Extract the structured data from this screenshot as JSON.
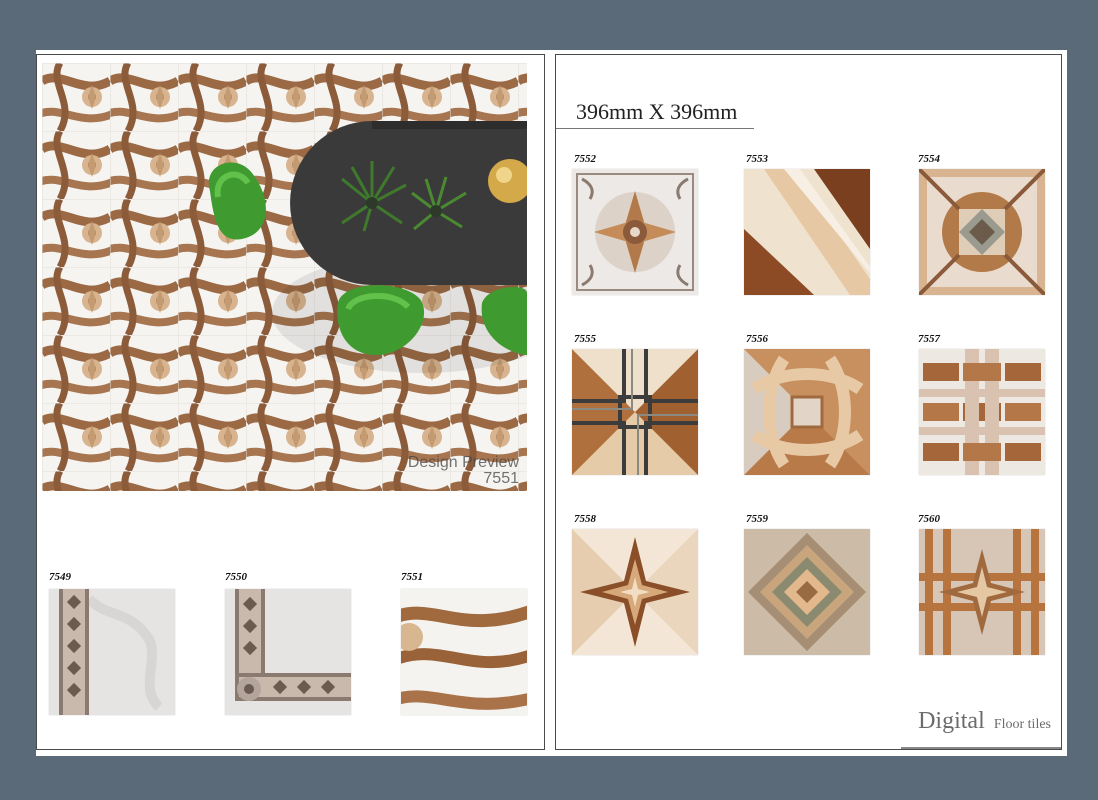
{
  "size_title": "396mm X 396mm",
  "preview": {
    "caption_line1": "Design Preview",
    "caption_line2": "7551"
  },
  "left_tiles": [
    {
      "code": "7549"
    },
    {
      "code": "7550"
    },
    {
      "code": "7551"
    }
  ],
  "right_tiles": [
    {
      "code": "7552"
    },
    {
      "code": "7553"
    },
    {
      "code": "7554"
    },
    {
      "code": "7555"
    },
    {
      "code": "7556"
    },
    {
      "code": "7557"
    },
    {
      "code": "7558"
    },
    {
      "code": "7559"
    },
    {
      "code": "7560"
    }
  ],
  "brand": {
    "main": "Digital",
    "sub": "Floor tiles"
  },
  "colors": {
    "background": "#5a6a79",
    "sheet": "#ffffff",
    "wood_dark": "#8a5a3a",
    "wood_light": "#d9b48e",
    "chair_green": "#3f9a2f",
    "table": "#3b3a3a"
  }
}
